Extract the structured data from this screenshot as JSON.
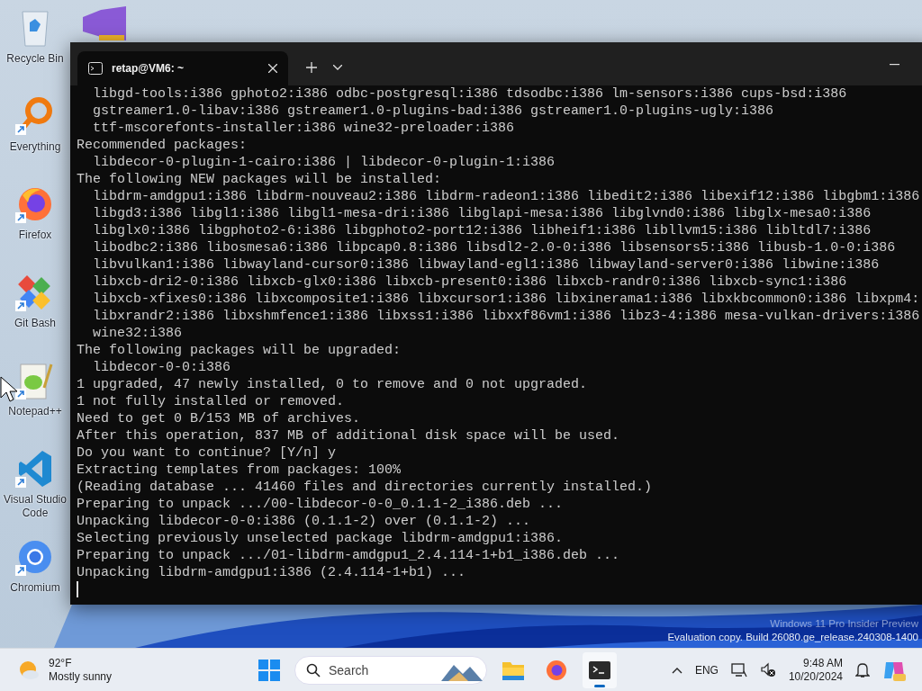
{
  "desktop_icons": [
    {
      "label": "Recycle Bin",
      "kind": "recycle",
      "shortcut": false
    },
    {
      "label": "Everything",
      "kind": "search",
      "shortcut": true
    },
    {
      "label": "Firefox",
      "kind": "firefox",
      "shortcut": true
    },
    {
      "label": "Git Bash",
      "kind": "git",
      "shortcut": true
    },
    {
      "label": "Notepad++",
      "kind": "notepad",
      "shortcut": true
    },
    {
      "label": "Visual Studio Code",
      "kind": "vscode",
      "shortcut": true
    },
    {
      "label": "Chromium",
      "kind": "chromium",
      "shortcut": true
    }
  ],
  "terminal": {
    "tab": {
      "title": "retap@VM6: ~",
      "selected": true
    },
    "lines": [
      "  libgd-tools:i386 gphoto2:i386 odbc-postgresql:i386 tdsodbc:i386 lm-sensors:i386 cups-bsd:i386",
      "  gstreamer1.0-libav:i386 gstreamer1.0-plugins-bad:i386 gstreamer1.0-plugins-ugly:i386",
      "  ttf-mscorefonts-installer:i386 wine32-preloader:i386",
      "Recommended packages:",
      "  libdecor-0-plugin-1-cairo:i386 | libdecor-0-plugin-1:i386",
      "The following NEW packages will be installed:",
      "  libdrm-amdgpu1:i386 libdrm-nouveau2:i386 libdrm-radeon1:i386 libedit2:i386 libexif12:i386 libgbm1:i386",
      "  libgd3:i386 libgl1:i386 libgl1-mesa-dri:i386 libglapi-mesa:i386 libglvnd0:i386 libglx-mesa0:i386",
      "  libglx0:i386 libgphoto2-6:i386 libgphoto2-port12:i386 libheif1:i386 libllvm15:i386 libltdl7:i386",
      "  libodbc2:i386 libosmesa6:i386 libpcap0.8:i386 libsdl2-2.0-0:i386 libsensors5:i386 libusb-1.0-0:i386",
      "  libvulkan1:i386 libwayland-cursor0:i386 libwayland-egl1:i386 libwayland-server0:i386 libwine:i386",
      "  libxcb-dri2-0:i386 libxcb-glx0:i386 libxcb-present0:i386 libxcb-randr0:i386 libxcb-sync1:i386",
      "  libxcb-xfixes0:i386 libxcomposite1:i386 libxcursor1:i386 libxinerama1:i386 libxkbcommon0:i386 libxpm4:",
      "  libxrandr2:i386 libxshmfence1:i386 libxss1:i386 libxxf86vm1:i386 libz3-4:i386 mesa-vulkan-drivers:i386",
      "  wine32:i386",
      "The following packages will be upgraded:",
      "  libdecor-0-0:i386",
      "1 upgraded, 47 newly installed, 0 to remove and 0 not upgraded.",
      "1 not fully installed or removed.",
      "Need to get 0 B/153 MB of archives.",
      "After this operation, 837 MB of additional disk space will be used.",
      "Do you want to continue? [Y/n] y",
      "Extracting templates from packages: 100%",
      "(Reading database ... 41460 files and directories currently installed.)",
      "Preparing to unpack .../00-libdecor-0-0_0.1.1-2_i386.deb ...",
      "Unpacking libdecor-0-0:i386 (0.1.1-2) over (0.1.1-2) ...",
      "Selecting previously unselected package libdrm-amdgpu1:i386.",
      "Preparing to unpack .../01-libdrm-amdgpu1_2.4.114-1+b1_i386.deb ...",
      "Unpacking libdrm-amdgpu1:i386 (2.4.114-1+b1) ..."
    ]
  },
  "watermark": [
    "Windows 11 Pro Insider Preview",
    "Evaluation copy. Build 26080.ge_release.240308-1400"
  ],
  "taskbar": {
    "weather": {
      "temperature": "92°F",
      "condition": "Mostly sunny"
    },
    "search": {
      "placeholder": "Search"
    },
    "apps": [
      {
        "kind": "explorer",
        "selected": false
      },
      {
        "kind": "firefox",
        "selected": false
      },
      {
        "kind": "terminal",
        "selected": true
      }
    ],
    "language": "ENG",
    "time": "9:48 AM",
    "date": "10/20/2024"
  }
}
